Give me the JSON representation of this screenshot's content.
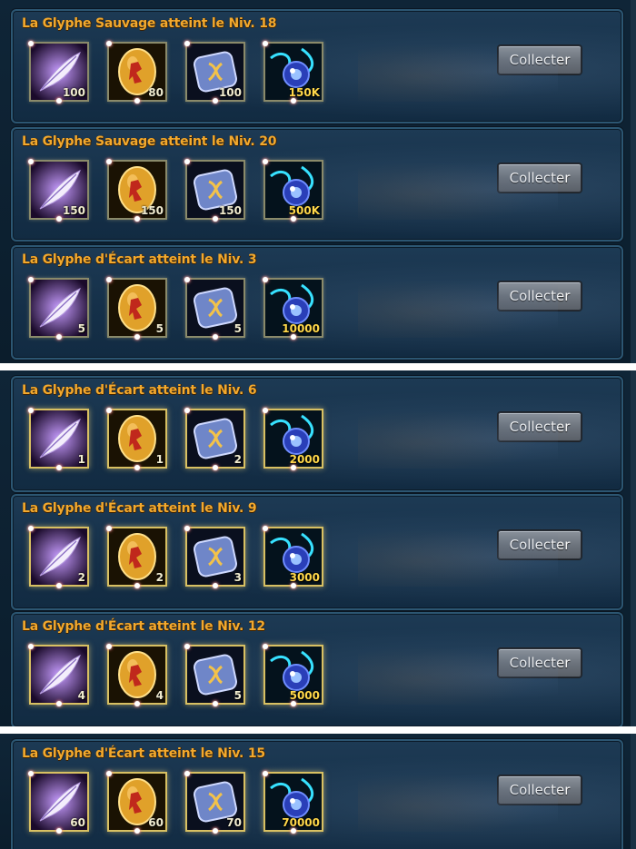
{
  "button_label": "Collecter",
  "colors": {
    "title": "#f2a92e",
    "item_border": "#d8c062",
    "panel_bg": "#153049",
    "quantity_gold": "#ffd84a"
  },
  "item_icons": [
    "feather-icon",
    "golden-egg-icon",
    "rune-stone-icon",
    "blue-orb-icon"
  ],
  "rows": [
    {
      "title": "La Glyphe Sauvage atteint le Niv. 18",
      "items": [
        {
          "qty": "100"
        },
        {
          "qty": "80"
        },
        {
          "qty": "100"
        },
        {
          "qty": "150K"
        }
      ]
    },
    {
      "title": "La Glyphe Sauvage atteint le Niv. 20",
      "items": [
        {
          "qty": "150"
        },
        {
          "qty": "150"
        },
        {
          "qty": "150"
        },
        {
          "qty": "500K"
        }
      ]
    },
    {
      "title": "La Glyphe d'Écart atteint le Niv. 3",
      "items": [
        {
          "qty": "5"
        },
        {
          "qty": "5"
        },
        {
          "qty": "5"
        },
        {
          "qty": "10000"
        }
      ]
    },
    {
      "title": "La Glyphe d'Écart atteint le Niv. 6",
      "items": [
        {
          "qty": "1"
        },
        {
          "qty": "1"
        },
        {
          "qty": "2"
        },
        {
          "qty": "2000"
        }
      ]
    },
    {
      "title": "La Glyphe d'Écart atteint le Niv. 9",
      "items": [
        {
          "qty": "2"
        },
        {
          "qty": "2"
        },
        {
          "qty": "3"
        },
        {
          "qty": "3000"
        }
      ]
    },
    {
      "title": "La Glyphe d'Écart atteint le Niv. 12",
      "items": [
        {
          "qty": "4"
        },
        {
          "qty": "4"
        },
        {
          "qty": "5"
        },
        {
          "qty": "5000"
        }
      ]
    },
    {
      "title": "La Glyphe d'Écart atteint le Niv. 15",
      "items": [
        {
          "qty": "60"
        },
        {
          "qty": "60"
        },
        {
          "qty": "70"
        },
        {
          "qty": "70000"
        }
      ]
    }
  ]
}
